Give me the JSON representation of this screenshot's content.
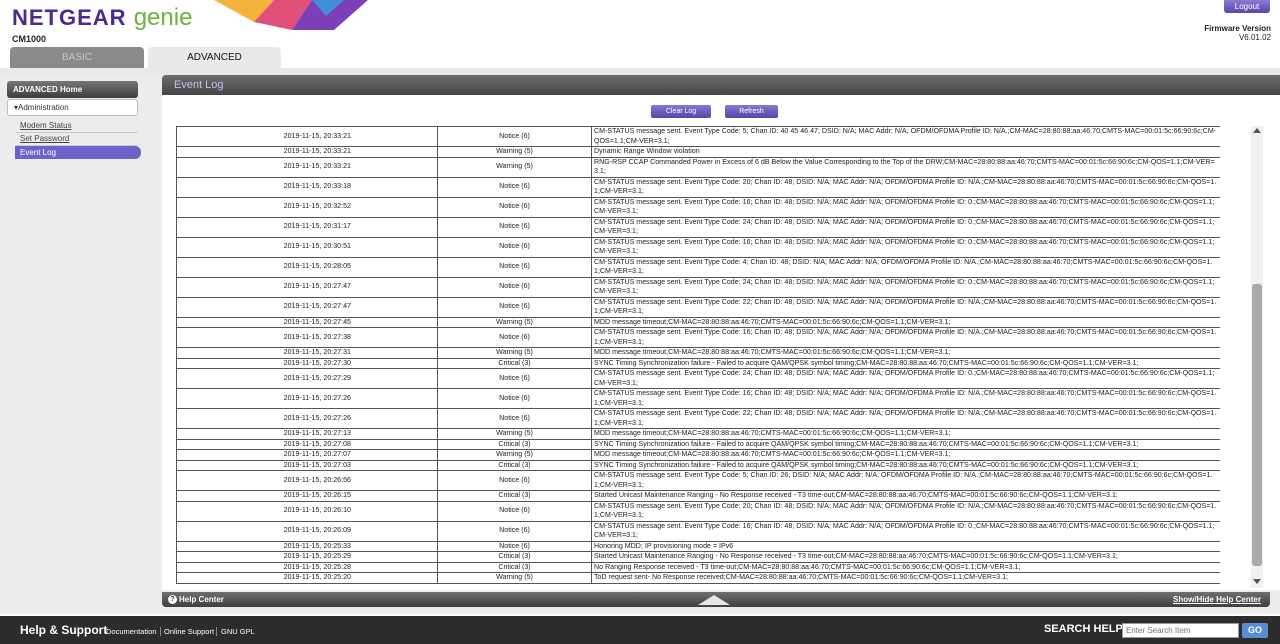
{
  "header": {
    "logo_brand": "NETGEAR",
    "logo_product": "genie",
    "model": "CM1000",
    "logout_label": "Logout",
    "firmware_label": "Firmware Version",
    "firmware_version": "V6.01.02"
  },
  "tabs": [
    {
      "label": "BASIC"
    },
    {
      "label": "ADVANCED"
    }
  ],
  "sidebar": {
    "home_label": "ADVANCED Home",
    "section_label": "▾Administration",
    "items": [
      {
        "label": "Modem Status"
      },
      {
        "label": "Set Password"
      },
      {
        "label": "Event Log"
      }
    ]
  },
  "panel": {
    "title": "Event Log",
    "clear_label": "Clear Log",
    "refresh_label": "Refresh"
  },
  "log": {
    "rows": [
      {
        "time": "2019-11-15, 20:33:21",
        "priority": "Notice (6)",
        "description": "CM-STATUS message sent. Event Type Code: 5; Chan ID: 40 45 46 47; DSID: N/A; MAC Addr: N/A; OFDM/OFDMA Profile ID: N/A.;CM-MAC=28:80:88:aa:46:70;CMTS-MAC=00:01:5c:66:90:6c;CM-QOS=1.1;CM-VER=3.1;"
      },
      {
        "time": "2019-11-15, 20:33:21",
        "priority": "Warning (5)",
        "description": "Dynamic Range Window violation"
      },
      {
        "time": "2019-11-15, 20:33:21",
        "priority": "Warning (5)",
        "description": "RNG-RSP CCAP Commanded Power in Excess of 6 dB Below the Value Corresponding to the Top of the DRW;CM-MAC=28:80:88:aa:46:70;CMTS-MAC=00:01:5c:66:90:6c;CM-QOS=1.1;CM-VER=3.1;"
      },
      {
        "time": "2019-11-15, 20:33:18",
        "priority": "Notice (6)",
        "description": "CM-STATUS message sent. Event Type Code: 20; Chan ID: 48; DSID: N/A; MAC Addr: N/A; OFDM/OFDMA Profile ID: N/A.;CM-MAC=28:80:88:aa:46:70;CMTS-MAC=00:01:5c:66:90:6c;CM-QOS=1.1;CM-VER=3.1;"
      },
      {
        "time": "2019-11-15, 20:32:52",
        "priority": "Notice (6)",
        "description": "CM-STATUS message sent. Event Type Code: 16; Chan ID: 48; DSID: N/A; MAC Addr: N/A; OFDM/OFDMA Profile ID: 0.;CM-MAC=28:80:88:aa:46:70;CMTS-MAC=00:01:5c:66:90:6c;CM-QOS=1.1;CM-VER=3.1;"
      },
      {
        "time": "2019-11-15, 20:31:17",
        "priority": "Notice (6)",
        "description": "CM-STATUS message sent. Event Type Code: 24; Chan ID: 48; DSID: N/A; MAC Addr: N/A; OFDM/OFDMA Profile ID: 0.;CM-MAC=28:80:88:aa:46:70;CMTS-MAC=00:01:5c:66:90:6c;CM-QOS=1.1;CM-VER=3.1;"
      },
      {
        "time": "2019-11-15, 20:30:51",
        "priority": "Notice (6)",
        "description": "CM-STATUS message sent. Event Type Code: 16; Chan ID: 48; DSID: N/A; MAC Addr: N/A; OFDM/OFDMA Profile ID: 0.;CM-MAC=28:80:88:aa:46:70;CMTS-MAC=00:01:5c:66:90:6c;CM-QOS=1.1;CM-VER=3.1;"
      },
      {
        "time": "2019-11-15, 20:28:05",
        "priority": "Notice (6)",
        "description": "CM-STATUS message sent. Event Type Code: 4; Chan ID: 48; DSID: N/A; MAC Addr: N/A; OFDM/OFDMA Profile ID: N/A.;CM-MAC=28:80:88:aa:46:70;CMTS-MAC=00:01:5c:66:90:6c;CM-QOS=1.1;CM-VER=3.1;"
      },
      {
        "time": "2019-11-15, 20:27:47",
        "priority": "Notice (6)",
        "description": "CM-STATUS message sent. Event Type Code: 24; Chan ID: 48; DSID: N/A; MAC Addr: N/A; OFDM/OFDMA Profile ID: 0.;CM-MAC=28:80:88:aa:46:70;CMTS-MAC=00:01:5c:66:90:6c;CM-QOS=1.1;CM-VER=3.1;"
      },
      {
        "time": "2019-11-15, 20:27:47",
        "priority": "Notice (6)",
        "description": "CM-STATUS message sent. Event Type Code: 22; Chan ID: 48; DSID: N/A; MAC Addr: N/A; OFDM/OFDMA Profile ID: N/A.;CM-MAC=28:80:88:aa:46:70;CMTS-MAC=00:01:5c:66:90:6c;CM-QOS=1.1;CM-VER=3.1;"
      },
      {
        "time": "2019-11-15, 20:27:45",
        "priority": "Warning (5)",
        "description": "MDD message timeout;CM-MAC=28:80:88:aa:46:70;CMTS-MAC=00:01:5c:66:90:6c;CM-QOS=1.1;CM-VER=3.1;"
      },
      {
        "time": "2019-11-15, 20:27:38",
        "priority": "Notice (6)",
        "description": "CM-STATUS message sent. Event Type Code: 16; Chan ID: 48; DSID: N/A; MAC Addr: N/A; OFDM/OFDMA Profile ID: N/A.;CM-MAC=28:80:88:aa:46:70;CMTS-MAC=00:01:5c:66:90:6c;CM-QOS=1.1;CM-VER=3.1;"
      },
      {
        "time": "2019-11-15, 20:27:31",
        "priority": "Warning (5)",
        "description": "MDD message timeout;CM-MAC=28:80:88:aa:46:70;CMTS-MAC=00:01:5c:66:90:6c;CM-QOS=1.1;CM-VER=3.1;"
      },
      {
        "time": "2019-11-15, 20:27:30",
        "priority": "Critical (3)",
        "description": "SYNC Timing Synchronization failure - Failed to acquire QAM/QPSK symbol timing;CM-MAC=28:80:88:aa:46:70;CMTS-MAC=00:01:5c:66:90:6c;CM-QOS=1.1;CM-VER=3.1;"
      },
      {
        "time": "2019-11-15, 20:27:29",
        "priority": "Notice (6)",
        "description": "CM-STATUS message sent. Event Type Code: 24; Chan ID: 48; DSID: N/A; MAC Addr: N/A; OFDM/OFDMA Profile ID: 0.;CM-MAC=28:80:88:aa:46:70;CMTS-MAC=00:01:5c:66:90:6c;CM-QOS=1.1;CM-VER=3.1;"
      },
      {
        "time": "2019-11-15, 20:27:26",
        "priority": "Notice (6)",
        "description": "CM-STATUS message sent. Event Type Code: 16; Chan ID: 48; DSID: N/A; MAC Addr: N/A; OFDM/OFDMA Profile ID: N/A.;CM-MAC=28:80:88:aa:46:70;CMTS-MAC=00:01:5c:66:90:6c;CM-QOS=1.1;CM-VER=3.1;"
      },
      {
        "time": "2019-11-15, 20:27:26",
        "priority": "Notice (6)",
        "description": "CM-STATUS message sent. Event Type Code: 22; Chan ID: 48; DSID: N/A; MAC Addr: N/A; OFDM/OFDMA Profile ID: N/A.;CM-MAC=28:80:88:aa:46:70;CMTS-MAC=00:01:5c:66:90:6c;CM-QOS=1.1;CM-VER=3.1;"
      },
      {
        "time": "2019-11-15, 20:27:13",
        "priority": "Warning (5)",
        "description": "MDD message timeout;CM-MAC=28:80:88:aa:46:70;CMTS-MAC=00:01:5c:66:90:6c;CM-QOS=1.1;CM-VER=3.1;"
      },
      {
        "time": "2019-11-15, 20:27:08",
        "priority": "Critical (3)",
        "description": "SYNC Timing Synchronization failure - Failed to acquire QAM/QPSK symbol timing;CM-MAC=28:80:88:aa:46:70;CMTS-MAC=00:01:5c:66:90:6c;CM-QOS=1.1;CM-VER=3.1;"
      },
      {
        "time": "2019-11-15, 20:27:07",
        "priority": "Warning (5)",
        "description": "MDD message timeout;CM-MAC=28:80:88:aa:46:70;CMTS-MAC=00:01:5c:66:90:6c;CM-QOS=1.1;CM-VER=3.1;"
      },
      {
        "time": "2019-11-15, 20:27:03",
        "priority": "Critical (3)",
        "description": "SYNC Timing Synchronization failure - Failed to acquire QAM/QPSK symbol timing;CM-MAC=28:80:88:aa:46:70;CMTS-MAC=00:01:5c:66:90:6c;CM-QOS=1.1;CM-VER=3.1;"
      },
      {
        "time": "2019-11-15, 20:26:56",
        "priority": "Notice (6)",
        "description": "CM-STATUS message sent. Event Type Code: 5; Chan ID: 26; DSID: N/A; MAC Addr: N/A; OFDM/OFDMA Profile ID: N/A.;CM-MAC=28:80:88:aa:46:70;CMTS-MAC=00:01:5c:66:90:6c;CM-QOS=1.1;CM-VER=3.1;"
      },
      {
        "time": "2019-11-15, 20:26:15",
        "priority": "Critical (3)",
        "description": "Started Unicast Maintenance Ranging - No Response received - T3 time-out;CM-MAC=28:80:88:aa:46:70;CMTS-MAC=00:01:5c:66:90:6c;CM-QOS=1.1;CM-VER=3.1;"
      },
      {
        "time": "2019-11-15, 20:26:10",
        "priority": "Notice (6)",
        "description": "CM-STATUS message sent. Event Type Code: 20; Chan ID: 48; DSID: N/A; MAC Addr: N/A; OFDM/OFDMA Profile ID: N/A.;CM-MAC=28:80:88:aa:46:70;CMTS-MAC=00:01:5c:66:90:6c;CM-QOS=1.1;CM-VER=3.1;"
      },
      {
        "time": "2019-11-15, 20:26:09",
        "priority": "Notice (6)",
        "description": "CM-STATUS message sent. Event Type Code: 16; Chan ID: 48; DSID: N/A; MAC Addr: N/A; OFDM/OFDMA Profile ID: 0.;CM-MAC=28:80:88:aa:46:70;CMTS-MAC=00:01:5c:66:90:6c;CM-QOS=1.1;CM-VER=3.1;"
      },
      {
        "time": "2019-11-15, 20:25:33",
        "priority": "Notice (6)",
        "description": "Honoring MDD; IP provisioning mode = IPv6"
      },
      {
        "time": "2019-11-15, 20:25:29",
        "priority": "Critical (3)",
        "description": "Started Unicast Maintenance Ranging - No Response received - T3 time-out;CM-MAC=28:80:88:aa:46:70;CMTS-MAC=00:01:5c:66:90:6c;CM-QOS=1.1;CM-VER=3.1;"
      },
      {
        "time": "2019-11-15, 20:25:28",
        "priority": "Critical (3)",
        "description": "No Ranging Response received - T3 time-out;CM-MAC=28:80:88:aa:46:70;CMTS-MAC=00:01:5c:66:90:6c;CM-QOS=1.1;CM-VER=3.1;"
      },
      {
        "time": "2019-11-15, 20:25:20",
        "priority": "Warning (5)",
        "description": "ToD request sent- No Response received;CM-MAC=28:80:88:aa:46:70;CMTS-MAC=00:01:5c:66:90:6c;CM-QOS=1.1;CM-VER=3.1;"
      }
    ]
  },
  "helpbar": {
    "help_label": "Help Center",
    "toggle_label": "Show/Hide Help Center"
  },
  "footer": {
    "title": "Help & Support",
    "links": [
      {
        "label": "Documentation"
      },
      {
        "label": "Online Support"
      },
      {
        "label": "GNU GPL"
      }
    ],
    "search_label": "SEARCH HELP",
    "search_placeholder": "Enter Search Item",
    "go_label": "GO"
  },
  "colors": {
    "accent_purple": "#6e62c8",
    "brand_purple": "#4b2a8c",
    "brand_green": "#6cb33f",
    "footer_bg": "#2c2c2c"
  }
}
